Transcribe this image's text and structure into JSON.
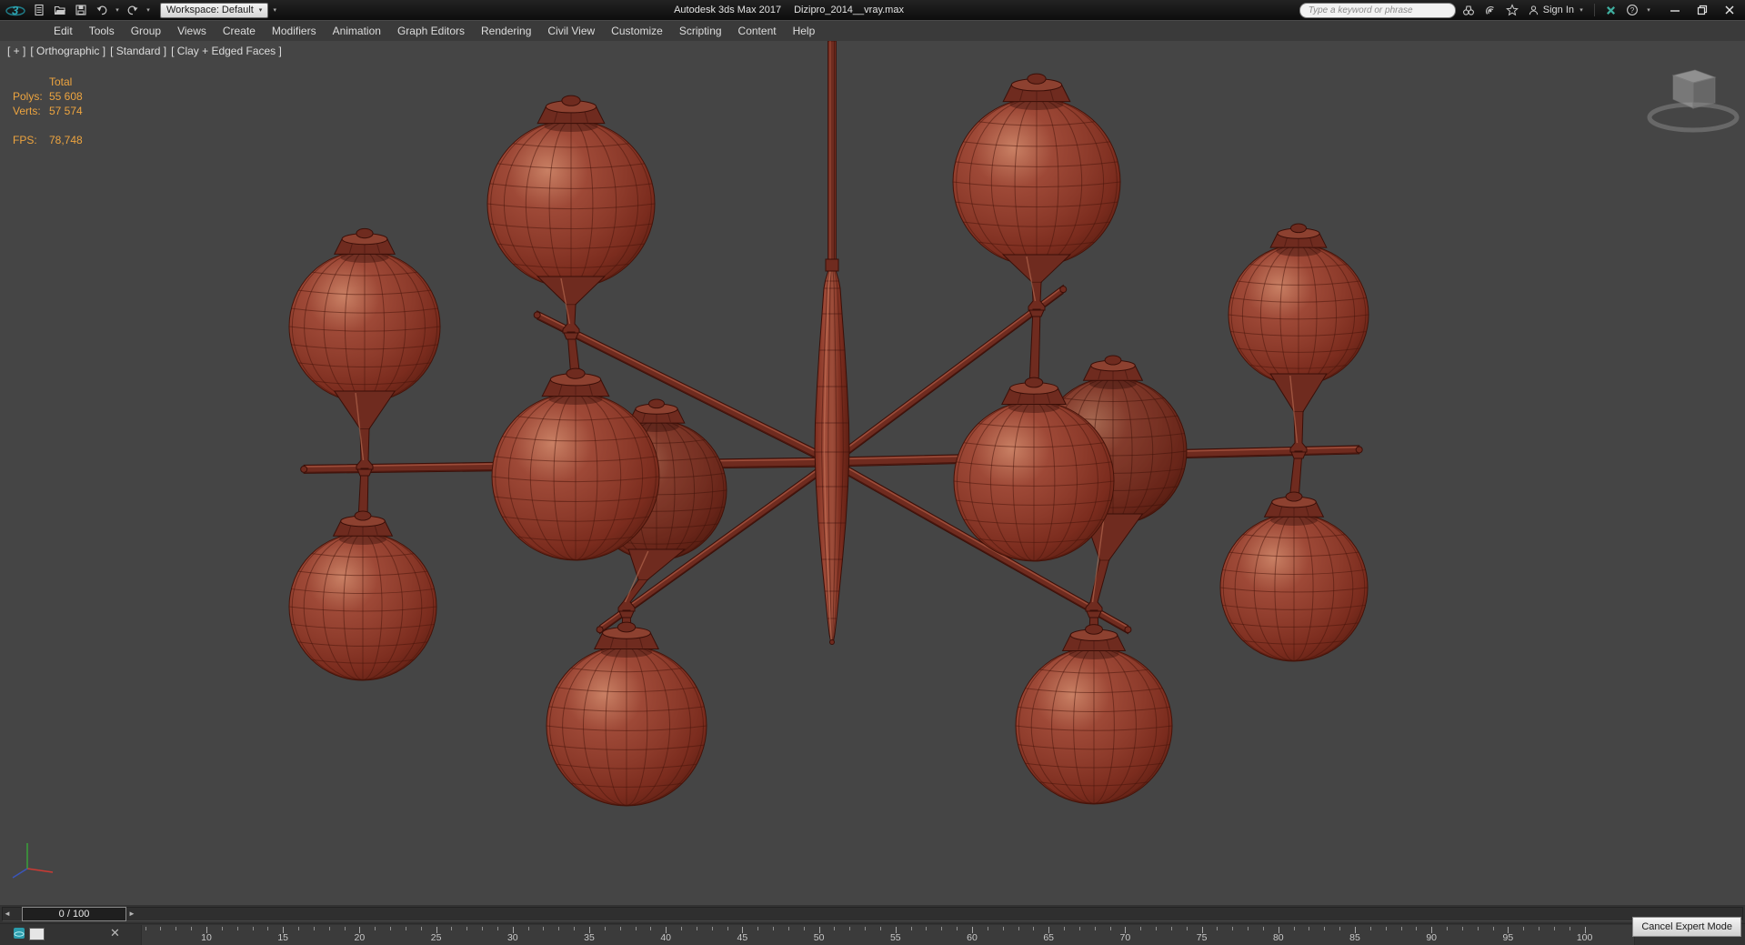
{
  "title_bar": {
    "window_title": {
      "app": "Autodesk 3ds Max 2017",
      "document": "Dizipro_2014__vray.max"
    },
    "workspace": {
      "label": "Workspace: Default"
    },
    "search": {
      "placeholder": "Type a keyword or phrase"
    },
    "sign_in": {
      "label": "Sign In"
    }
  },
  "menu_bar": {
    "items": [
      "Edit",
      "Tools",
      "Group",
      "Views",
      "Create",
      "Modifiers",
      "Animation",
      "Graph Editors",
      "Rendering",
      "Civil View",
      "Customize",
      "Scripting",
      "Content",
      "Help"
    ]
  },
  "viewport": {
    "label_segments": [
      "[ + ]",
      "[ Orthographic ]",
      "[ Standard ]",
      "[ Clay + Edged Faces ]"
    ],
    "statistics": {
      "header": "Total",
      "rows": [
        {
          "label": "Polys:",
          "value": "55 608"
        },
        {
          "label": "Verts:",
          "value": "57 574"
        }
      ],
      "fps": {
        "label": "FPS:",
        "value": "78,748"
      },
      "text_color": "#eda43f"
    },
    "background_color": "#454545",
    "model": {
      "name": "chandelier",
      "shading_mode": "Clay + Edged Faces",
      "clay_colors": {
        "highlight": "#c98064",
        "mid": "#9e4937",
        "dark_mid": "#8c3a2a",
        "deep": "#7b2c1e",
        "shadow": "#5c1f13",
        "edge": "#451309",
        "metal": "#6f2b1f",
        "metal_top": "#8d4130",
        "metal_highlight": "#9c4c39",
        "metal_edge": "#3a0f08"
      }
    }
  },
  "timeline": {
    "frame_display": "0 / 100",
    "prev_frame_glyph": "◄",
    "next_frame_glyph": "►",
    "ruler": {
      "label_start": 10,
      "label_end": 100,
      "label_step": 5,
      "frame_min": 0,
      "frame_max": 100
    },
    "cancel_expert_button": "Cancel Expert Mode"
  }
}
